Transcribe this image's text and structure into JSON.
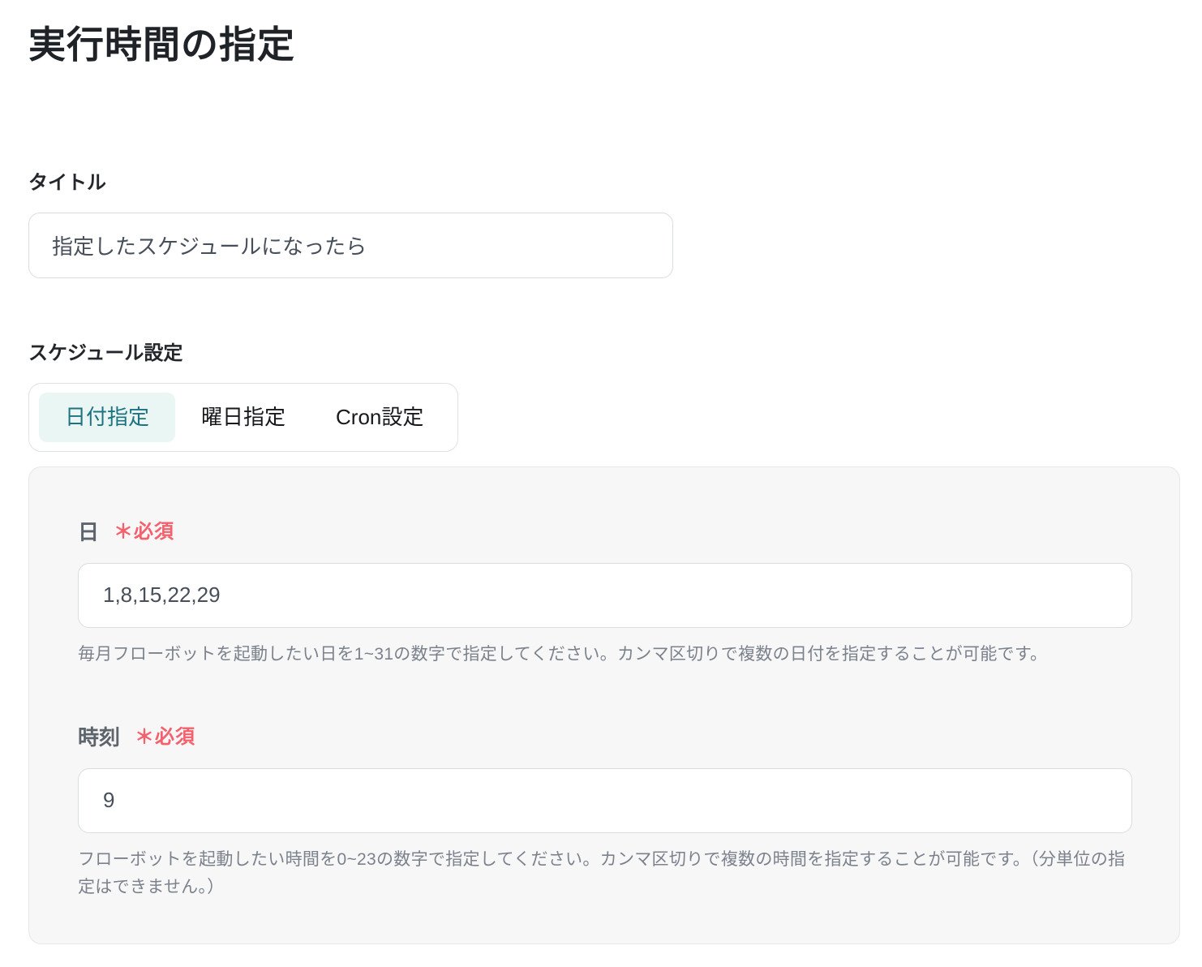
{
  "page": {
    "title": "実行時間の指定"
  },
  "title_field": {
    "label": "タイトル",
    "value": "指定したスケジュールになったら"
  },
  "schedule": {
    "label": "スケジュール設定",
    "tabs": [
      {
        "label": "日付指定",
        "active": true
      },
      {
        "label": "曜日指定",
        "active": false
      },
      {
        "label": "Cron設定",
        "active": false
      }
    ],
    "fields": [
      {
        "label": "日",
        "required_label": "＊必須",
        "value": "1,8,15,22,29",
        "help": "毎月フローボットを起動したい日を1~31の数字で指定してください。カンマ区切りで複数の日付を指定することが可能です。"
      },
      {
        "label": "時刻",
        "required_label": "＊必須",
        "value": "9",
        "help": "フローボットを起動したい時間を0~23の数字で指定してください。カンマ区切りで複数の時間を指定することが可能です。（分単位の指定はできません。）"
      }
    ]
  },
  "colors": {
    "accent_teal": "#1e7382",
    "active_tab_bg": "#e9f6f3",
    "required_red": "#f4606c",
    "panel_bg": "#f7f7f8",
    "input_border": "#d9dde2"
  }
}
